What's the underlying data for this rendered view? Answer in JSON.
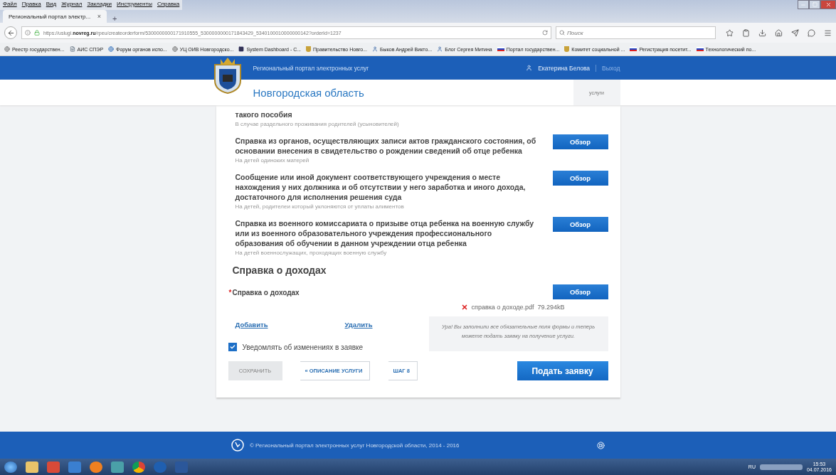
{
  "menu": [
    "Файл",
    "Правка",
    "Вид",
    "Журнал",
    "Закладки",
    "Инструменты",
    "Справка"
  ],
  "tab": {
    "title": "Региональный портал электр...",
    "close": "×",
    "new": "+"
  },
  "address": {
    "url_prefix": "https://uslugi.",
    "url_host": "novreg.ru",
    "url_path": "/rpeu/createorderform/5300000000171910555_5300000000171843429_5340100010000000142?orderId=1237"
  },
  "search": {
    "placeholder": "Поиск"
  },
  "bookmarks": [
    {
      "label": "Реестр государствен...",
      "kind": "globe"
    },
    {
      "label": "АИС СПЭР",
      "kind": "page"
    },
    {
      "label": "Форум органов испо...",
      "kind": "forum"
    },
    {
      "label": "УЦ ОИВ Новгородско...",
      "kind": "globe"
    },
    {
      "label": "System Dashboard - C...",
      "kind": "dash"
    },
    {
      "label": "Правительство Новго...",
      "kind": "crest"
    },
    {
      "label": "Быков Андрей Викто...",
      "kind": "user"
    },
    {
      "label": "Блог Сергея Митина",
      "kind": "user"
    },
    {
      "label": "Портал государствен...",
      "kind": "flag"
    },
    {
      "label": "Комитет социальной ...",
      "kind": "crest"
    },
    {
      "label": "Регистрация посетит...",
      "kind": "flag"
    },
    {
      "label": "Технологический по...",
      "kind": "flag"
    }
  ],
  "portal": {
    "name": "Региональный портал электронных услуг",
    "user": "Екатерина Белова",
    "logout": "Выход",
    "region": "Новгородская область",
    "nav": "услуги"
  },
  "documents": [
    {
      "title": "такого пособия",
      "note": "В случае раздельного проживания родителей (усыновителей)"
    },
    {
      "title": "Справка из органов, осуществляющих записи актов гражданского состояния, об основании внесения в свидетельство о рождении сведений об отце ребенка",
      "note": "На детей одиноких матерей",
      "button": "Обзор"
    },
    {
      "title": "Сообщение или иной документ соответствующего учреждения о месте нахождения у них должника и об отсутствии у него заработка и иного дохода, достаточного для исполнения решения суда",
      "note": "На детей, родителеи который уклоняются от уплаты алиментов",
      "button": "Обзор"
    },
    {
      "title": "Справка из военного комиссариата о призыве отца ребенка на военную службу или из военного образовательного учреждения профессионального образования об обучении в данном учреждении отца ребенка",
      "note": "На детей военнослужащих, проходящих военную службу",
      "button": "Обзор"
    }
  ],
  "income": {
    "heading": "Справка о доходах",
    "label": "Справка о доходах",
    "required_mark": "*",
    "button": "Обзор",
    "file_name": "справка о доходе.pdf",
    "file_size": "79.294kB"
  },
  "links": [
    "Добавить",
    "Удалить"
  ],
  "tooltip": "Ура! Вы заполнили все обязательные поля формы и теперь можете подать заявку на получение услуги.",
  "notify": {
    "label": "Уведомлять об изменениях в заявке",
    "checked": true
  },
  "actions": {
    "save": {
      "label": "СОХРАНИТЬ",
      "disabled": true
    },
    "back": "« ОПИСАНИЕ УСЛУГИ",
    "step": "ШАГ 8",
    "submit": "Подать заявку"
  },
  "footer": "© Региональный портал электронных услуг Новгородской области, 2014 - 2016",
  "taskbar": {
    "lang": "RU",
    "time": "15:53",
    "date": "04.07.2016"
  }
}
